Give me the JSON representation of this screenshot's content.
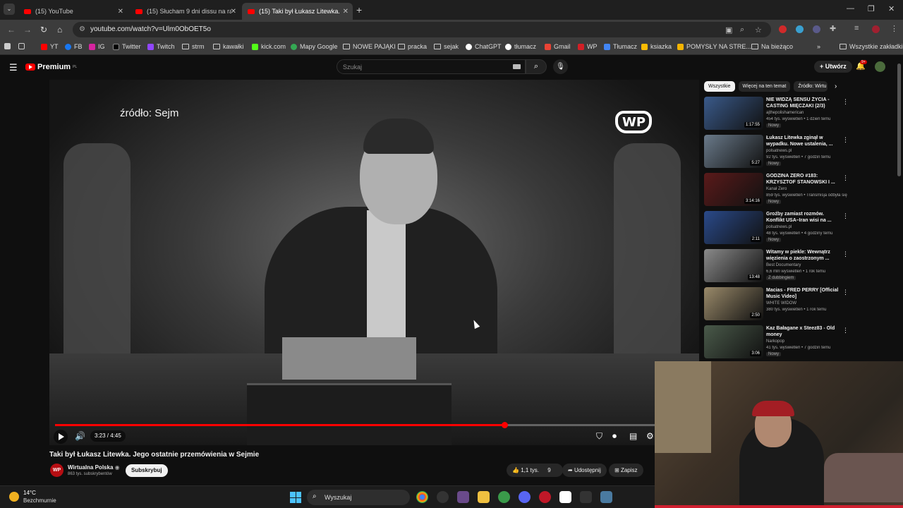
{
  "browser": {
    "tabs": [
      {
        "label": "(15) YouTube"
      },
      {
        "label": "(15) Słucham 9 dni dissu na raki"
      },
      {
        "label": "(15) Taki był Łukasz Litewka. Jeg"
      }
    ],
    "url": "youtube.com/watch?v=Ulm0ObOET5o",
    "bookmarks": [
      "YT",
      "FB",
      "IG",
      "Twitter",
      "Twitch",
      "strm",
      "kawałki",
      "kick.com",
      "Mapy Google",
      "NOWE PAJĄKI",
      "pracka",
      "sejak",
      "ChatGPT",
      "tłumacz",
      "Gmail",
      "WP",
      "Tłumacz",
      "ksiazka",
      "POMYSŁY NA STRE...",
      "Na bieżąco"
    ],
    "all_bookmarks": "Wszystkie zakładki"
  },
  "youtube": {
    "logo": "Premium",
    "logo_region": "PL",
    "search_placeholder": "Szukaj",
    "create_label": "Utwórz",
    "notification_count": "9+"
  },
  "video": {
    "overlay_source_prefix": "źródło:",
    "overlay_source": "Sejm",
    "logo_text": "WP",
    "time": "3:23 / 4:45",
    "progress": 0.7,
    "title": "Taki był Łukasz Litewka. Jego ostatnie przemówienia w Sejmie",
    "channel": "Wirtualna Polska",
    "channel_avatar": "WP",
    "subscribers": "863 tys. subskrybentów",
    "subscribe_label": "Subskrybuj",
    "likes": "1,1 tys.",
    "dislikes": "9",
    "share_label": "Udostępnij",
    "save_label": "Zapisz"
  },
  "chips": [
    "Wszystkie",
    "Więcej na ten temat",
    "Źródło: Wirtu"
  ],
  "recommendations": [
    {
      "title": "NIE WIDZĄ SENSU ŻYCIA - CASTING MIĘCZAKI (2/3)",
      "channel": "ajthepolishamerican",
      "meta": "454 tys. wyświetleń • 1 dzień temu",
      "badge": "Nowy",
      "duration": "1:17:55",
      "color": "#3a5a8a"
    },
    {
      "title": "Łukasz Litewka zginął w wypadku. Nowe ustalenia, ...",
      "channel": "polsatnews.pl",
      "meta": "92 tys. wyświetleń • 7 godzin temu",
      "badge": "Nowy",
      "duration": "5:27",
      "color": "#6a7a8a"
    },
    {
      "title": "GODZINA ZERO #183: KRZYSZTOF STANOWSKI I ...",
      "channel": "Kanał Zero",
      "meta": "859 tys. wyświetleń • Transmisja odbyła się",
      "badge": "Nowy",
      "duration": "3:14:16",
      "color": "#5a1a1a"
    },
    {
      "title": "Groźby zamiast rozmów. Konflikt USA–Iran wisi na ...",
      "channel": "polsatnews.pl",
      "meta": "48 tys. wyświetleń • 4 godziny temu",
      "badge": "Nowy",
      "duration": "2:11",
      "color": "#2a4a8a"
    },
    {
      "title": "Witamy w piekle: Wewnątrz więzienia o zaostrzonym ...",
      "channel": "Best Documentary",
      "meta": "6,6 mln wyświetleń • 1 rok temu",
      "badge": "Z dubbingiem",
      "duration": "13:48",
      "color": "#8a8a8a"
    },
    {
      "title": "Macias - FRED PERRY [Official Music Video]",
      "channel": "WHITE WIDOW",
      "meta": "380 tys. wyświetleń • 1 rok temu",
      "badge": "",
      "duration": "2:50",
      "color": "#9a8a6a"
    },
    {
      "title": "Kaz Bałagane x Steez83 - Old money",
      "channel": "Narkopop",
      "meta": "41 tys. wyświetleń • 7 godzin temu",
      "badge": "Nowy",
      "duration": "3:06",
      "color": "#4a5a4a"
    }
  ],
  "taskbar": {
    "temperature": "14°C",
    "condition": "Bezchmurnie",
    "search_placeholder": "Wyszukaj"
  }
}
